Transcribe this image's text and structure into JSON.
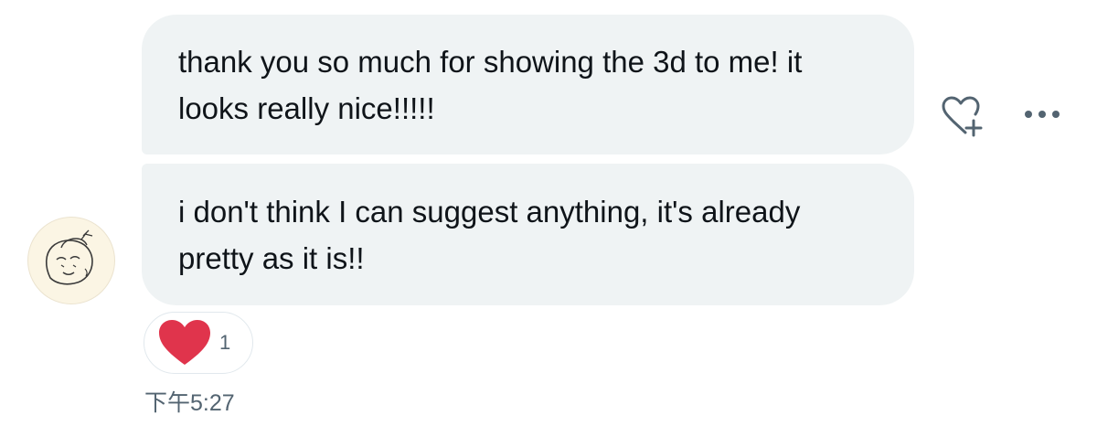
{
  "messages": [
    {
      "text": "thank you so much for showing the 3d to me! it\nlooks really nice!!!!!"
    },
    {
      "text": "i don't think I can suggest anything, it's already\npretty as it is!!"
    }
  ],
  "actions": {
    "react_icon": "heart-plus-icon",
    "more_icon": "more-horizontal-icon"
  },
  "reaction": {
    "emoji": "red-heart-icon",
    "count": "1"
  },
  "timestamp": "下午5:27",
  "colors": {
    "bubble_bg": "#eff3f4",
    "text": "#0f1419",
    "secondary_text": "#536471",
    "heart_red": "#e0344c"
  }
}
